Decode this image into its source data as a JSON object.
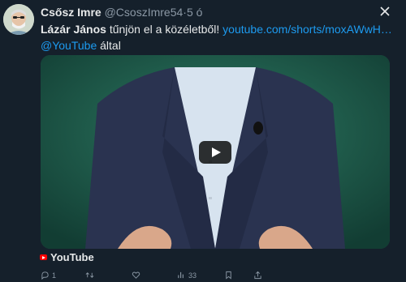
{
  "tweet": {
    "author_name": "Csősz Imre",
    "handle": "@CsoszImre54",
    "separator": "·",
    "time": "5 ó",
    "text_bold": "Lázár János",
    "text_rest": " tűnjön el a közéletből! ",
    "link": "youtube.com/shorts/moxAWwH…",
    "mention": "@YouTube",
    "via_word": " által"
  },
  "media": {
    "source_label": "YouTube"
  },
  "actions": {
    "reply_count": "1",
    "repost_count": "",
    "like_count": "",
    "views_count": "33"
  },
  "icons": [
    "close-icon",
    "play-icon",
    "youtube-icon",
    "reply-icon",
    "repost-icon",
    "like-icon",
    "views-icon",
    "bookmark-icon",
    "share-icon"
  ]
}
